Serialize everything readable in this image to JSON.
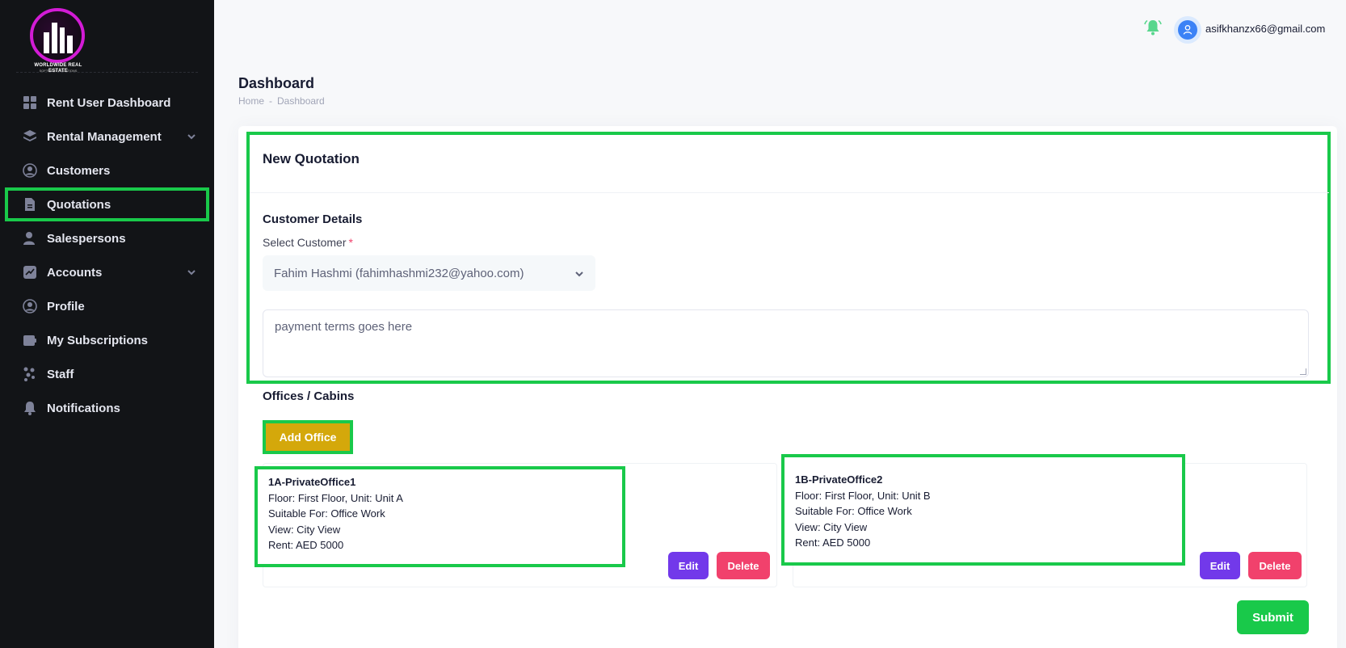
{
  "logo": {
    "line1": "WORLDWIDE REAL ESTATE",
    "line2": "SOFTWARE SOLUTIONS"
  },
  "sidebar": {
    "items": [
      {
        "label": "Rent User Dashboard",
        "icon": "grid-icon"
      },
      {
        "label": "Rental Management",
        "icon": "layers-icon",
        "has_chevron": true
      },
      {
        "label": "Customers",
        "icon": "user-circle-icon"
      },
      {
        "label": "Quotations",
        "icon": "document-icon",
        "active": true
      },
      {
        "label": "Salespersons",
        "icon": "person-icon"
      },
      {
        "label": "Accounts",
        "icon": "chart-icon",
        "has_chevron": true
      },
      {
        "label": "Profile",
        "icon": "profile-icon"
      },
      {
        "label": "My Subscriptions",
        "icon": "wallet-icon"
      },
      {
        "label": "Staff",
        "icon": "team-icon"
      },
      {
        "label": "Notifications",
        "icon": "bell-icon"
      }
    ]
  },
  "header": {
    "user_email": "asifkhanzx66@gmail.com"
  },
  "page": {
    "title": "Dashboard",
    "breadcrumb": [
      "Home",
      "Dashboard"
    ],
    "breadcrumb_sep": "-"
  },
  "quotation": {
    "title": "New Quotation",
    "customer_section": "Customer Details",
    "select_label": "Select Customer",
    "required_mark": "*",
    "selected_customer": "Fahim Hashmi (fahimhashmi232@yahoo.com)",
    "terms": "payment terms goes here",
    "offices_section": "Offices / Cabins",
    "add_office_label": "Add Office",
    "offices": [
      {
        "name": "1A-PrivateOffice1",
        "floor_unit": "Floor: First Floor, Unit: Unit A",
        "suitable": "Suitable For: Office Work",
        "view": "View: City View",
        "rent": "Rent: AED 5000"
      },
      {
        "name": "1B-PrivateOffice2",
        "floor_unit": "Floor: First Floor, Unit: Unit B",
        "suitable": "Suitable For: Office Work",
        "view": "View: City View",
        "rent": "Rent: AED 5000"
      }
    ],
    "edit_label": "Edit",
    "delete_label": "Delete",
    "submit_label": "Submit"
  },
  "colors": {
    "sidebar_bg": "#121417",
    "highlight": "#19c94a",
    "add_office": "#d4a80b",
    "edit": "#7239ea",
    "delete": "#f1416c",
    "submit": "#19c94a"
  }
}
